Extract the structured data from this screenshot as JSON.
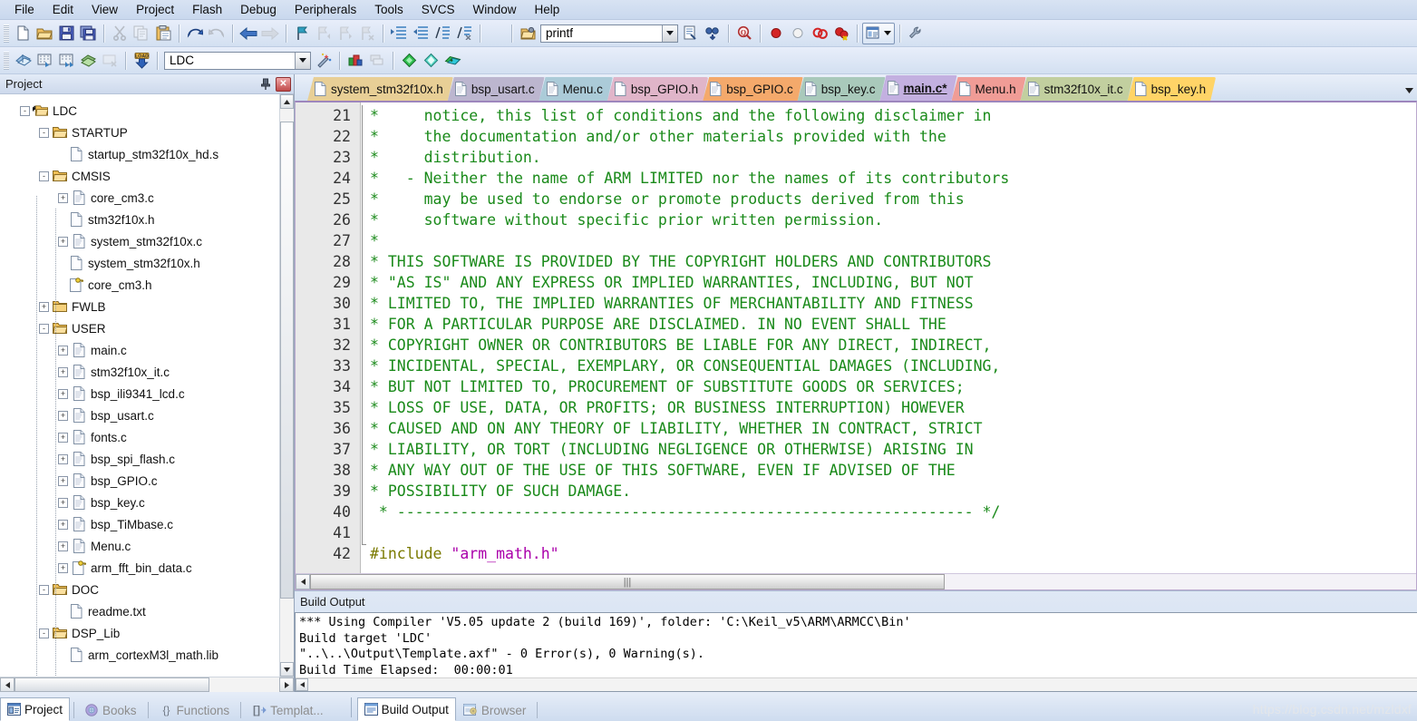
{
  "app": {
    "title": "Keil uVision5"
  },
  "menubar": {
    "items": [
      "File",
      "Edit",
      "View",
      "Project",
      "Flash",
      "Debug",
      "Peripherals",
      "Tools",
      "SVCS",
      "Window",
      "Help"
    ]
  },
  "toolbar_main": {
    "buttons": [
      {
        "name": "new-file",
        "icon": "new-document-icon",
        "disabled": false
      },
      {
        "name": "open-file",
        "icon": "open-folder-icon",
        "disabled": false
      },
      {
        "name": "save",
        "icon": "floppy-save-icon",
        "disabled": false
      },
      {
        "name": "save-all",
        "icon": "save-all-icon",
        "disabled": false
      },
      {
        "name": "cut",
        "icon": "scissors-icon",
        "disabled": true
      },
      {
        "name": "copy",
        "icon": "copy-icon",
        "disabled": true
      },
      {
        "name": "paste",
        "icon": "paste-icon",
        "disabled": false
      },
      {
        "name": "undo",
        "icon": "undo-arrow-icon",
        "disabled": false
      },
      {
        "name": "redo",
        "icon": "redo-arrow-icon",
        "disabled": true
      },
      {
        "name": "navigate-back",
        "icon": "arrow-left-icon",
        "disabled": false
      },
      {
        "name": "navigate-forward",
        "icon": "arrow-right-icon",
        "disabled": true
      },
      {
        "name": "bookmark-toggle",
        "icon": "bookmark-icon",
        "disabled": false
      },
      {
        "name": "bookmark-prev",
        "icon": "bookmark-prev-icon",
        "disabled": true
      },
      {
        "name": "bookmark-next",
        "icon": "bookmark-next-icon",
        "disabled": true
      },
      {
        "name": "bookmark-clear",
        "icon": "bookmark-clear-icon",
        "disabled": true
      },
      {
        "name": "indent",
        "icon": "indent-right-icon",
        "disabled": false
      },
      {
        "name": "outdent",
        "icon": "indent-left-icon",
        "disabled": false
      },
      {
        "name": "comment-lines",
        "icon": "comment-icon",
        "disabled": false
      },
      {
        "name": "uncomment-lines",
        "icon": "uncomment-icon",
        "disabled": false
      },
      {
        "name": "open-document",
        "icon": "open-doc-icon",
        "disabled": false
      }
    ],
    "search_box_value": "printf",
    "search_box_placeholder": "",
    "after_search": [
      {
        "name": "find-in-files",
        "icon": "find-in-files-icon",
        "disabled": false
      },
      {
        "name": "find-next",
        "icon": "binoculars-icon",
        "disabled": false
      },
      {
        "name": "incremental-find",
        "icon": "magnifier-icon",
        "disabled": false
      },
      {
        "name": "insert-breakpoint",
        "icon": "breakpoint-red-dot-icon",
        "disabled": false
      },
      {
        "name": "disable-breakpoint",
        "icon": "breakpoint-disabled-icon",
        "disabled": false
      },
      {
        "name": "kill-all-breakpoints",
        "icon": "breakpoints-clear-icon",
        "disabled": false
      },
      {
        "name": "disable-all-breakpoints",
        "icon": "breakpoints-disable-all-icon",
        "disabled": false
      },
      {
        "name": "window-layout",
        "icon": "window-layout-icon",
        "disabled": false
      },
      {
        "name": "configure-tools",
        "icon": "wrench-icon",
        "disabled": false
      }
    ]
  },
  "toolbar_build": {
    "buttons": [
      {
        "name": "translate-file",
        "icon": "translate-icon",
        "disabled": false
      },
      {
        "name": "build-target",
        "icon": "build-icon",
        "disabled": false
      },
      {
        "name": "rebuild-all",
        "icon": "rebuild-icon",
        "disabled": false
      },
      {
        "name": "batch-build",
        "icon": "batch-build-icon",
        "disabled": false
      },
      {
        "name": "stop-build",
        "icon": "stop-build-icon",
        "disabled": true
      },
      {
        "name": "download-to-flash",
        "icon": "load-download-icon",
        "disabled": false
      }
    ],
    "target_value": "LDC",
    "after_target": [
      {
        "name": "target-options",
        "icon": "magic-wand-icon",
        "disabled": false
      },
      {
        "name": "manage-project-items",
        "icon": "project-items-icon",
        "disabled": false
      },
      {
        "name": "multi-project",
        "icon": "multi-project-icon",
        "disabled": true
      },
      {
        "name": "pack-installer",
        "icon": "green-diamond-icon",
        "disabled": false
      },
      {
        "name": "manage-run-time",
        "icon": "teal-diamond-icon",
        "disabled": false
      },
      {
        "name": "select-software-packs",
        "icon": "packs-icon",
        "disabled": false
      }
    ]
  },
  "project_pane": {
    "title": "Project",
    "pin_icon": "pin-icon",
    "close_icon": "close-icon",
    "tree": [
      {
        "label": "LDC",
        "depth": 0,
        "type": "target",
        "expander": "-",
        "icon": "target-folder-icon"
      },
      {
        "label": "STARTUP",
        "depth": 1,
        "type": "group",
        "expander": "-",
        "icon": "folder-open-icon"
      },
      {
        "label": "startup_stm32f10x_hd.s",
        "depth": 2,
        "type": "file",
        "expander": "",
        "icon": "file-icon"
      },
      {
        "label": "CMSIS",
        "depth": 1,
        "type": "group",
        "expander": "-",
        "icon": "folder-open-icon"
      },
      {
        "label": "core_cm3.c",
        "depth": 2,
        "type": "file",
        "expander": "+",
        "icon": "file-c-icon"
      },
      {
        "label": "stm32f10x.h",
        "depth": 2,
        "type": "file",
        "expander": "",
        "icon": "file-icon"
      },
      {
        "label": "system_stm32f10x.c",
        "depth": 2,
        "type": "file",
        "expander": "+",
        "icon": "file-c-icon"
      },
      {
        "label": "system_stm32f10x.h",
        "depth": 2,
        "type": "file",
        "expander": "",
        "icon": "file-icon"
      },
      {
        "label": "core_cm3.h",
        "depth": 2,
        "type": "file",
        "expander": "",
        "icon": "file-key-icon"
      },
      {
        "label": "FWLB",
        "depth": 1,
        "type": "group",
        "expander": "+",
        "icon": "folder-closed-icon"
      },
      {
        "label": "USER",
        "depth": 1,
        "type": "group",
        "expander": "-",
        "icon": "folder-open-icon"
      },
      {
        "label": "main.c",
        "depth": 2,
        "type": "file",
        "expander": "+",
        "icon": "file-c-icon"
      },
      {
        "label": "stm32f10x_it.c",
        "depth": 2,
        "type": "file",
        "expander": "+",
        "icon": "file-c-icon"
      },
      {
        "label": "bsp_ili9341_lcd.c",
        "depth": 2,
        "type": "file",
        "expander": "+",
        "icon": "file-c-icon"
      },
      {
        "label": "bsp_usart.c",
        "depth": 2,
        "type": "file",
        "expander": "+",
        "icon": "file-c-icon"
      },
      {
        "label": "fonts.c",
        "depth": 2,
        "type": "file",
        "expander": "+",
        "icon": "file-c-icon"
      },
      {
        "label": "bsp_spi_flash.c",
        "depth": 2,
        "type": "file",
        "expander": "+",
        "icon": "file-c-icon"
      },
      {
        "label": "bsp_GPIO.c",
        "depth": 2,
        "type": "file",
        "expander": "+",
        "icon": "file-c-icon"
      },
      {
        "label": "bsp_key.c",
        "depth": 2,
        "type": "file",
        "expander": "+",
        "icon": "file-c-icon"
      },
      {
        "label": "bsp_TiMbase.c",
        "depth": 2,
        "type": "file",
        "expander": "+",
        "icon": "file-c-icon"
      },
      {
        "label": "Menu.c",
        "depth": 2,
        "type": "file",
        "expander": "+",
        "icon": "file-c-icon"
      },
      {
        "label": "arm_fft_bin_data.c",
        "depth": 2,
        "type": "file",
        "expander": "+",
        "icon": "file-key-icon"
      },
      {
        "label": "DOC",
        "depth": 1,
        "type": "group",
        "expander": "-",
        "icon": "folder-open-icon"
      },
      {
        "label": "readme.txt",
        "depth": 2,
        "type": "file",
        "expander": "",
        "icon": "file-icon"
      },
      {
        "label": "DSP_Lib",
        "depth": 1,
        "type": "group",
        "expander": "-",
        "icon": "folder-open-icon"
      },
      {
        "label": "arm_cortexM3l_math.lib",
        "depth": 2,
        "type": "file",
        "expander": "",
        "icon": "file-icon"
      }
    ]
  },
  "editor_tabs": {
    "items": [
      {
        "label": "system_stm32f10x.h",
        "color": "#e8cf96",
        "active": false,
        "modified": false,
        "icon": "file-icon"
      },
      {
        "label": "bsp_usart.c",
        "color": "#bcb6cf",
        "active": false,
        "modified": false,
        "icon": "file-c-icon"
      },
      {
        "label": "Menu.c",
        "color": "#abcbd8",
        "active": false,
        "modified": false,
        "icon": "file-c-icon"
      },
      {
        "label": "bsp_GPIO.h",
        "color": "#e0b5c9",
        "active": false,
        "modified": false,
        "icon": "file-icon"
      },
      {
        "label": "bsp_GPIO.c",
        "color": "#f4a96b",
        "active": false,
        "modified": false,
        "icon": "file-c-icon"
      },
      {
        "label": "bsp_key.c",
        "color": "#a9c9bb",
        "active": false,
        "modified": false,
        "icon": "file-c-icon"
      },
      {
        "label": "main.c*",
        "color": "#c3b0e0",
        "active": true,
        "modified": true,
        "icon": "file-c-icon"
      },
      {
        "label": "Menu.h",
        "color": "#f09c96",
        "active": false,
        "modified": false,
        "icon": "file-icon"
      },
      {
        "label": "stm32f10x_it.c",
        "color": "#c2cf9f",
        "active": false,
        "modified": false,
        "icon": "file-c-icon"
      },
      {
        "label": "bsp_key.h",
        "color": "#ffd467",
        "active": false,
        "modified": false,
        "icon": "file-icon"
      }
    ],
    "overflow_icon": "chevron-down-icon"
  },
  "code": {
    "first_line_number": 21,
    "lines": [
      {
        "n": 21,
        "type": "comment",
        "text": "*     notice, this list of conditions and the following disclaimer in"
      },
      {
        "n": 22,
        "type": "comment",
        "text": "*     the documentation and/or other materials provided with the"
      },
      {
        "n": 23,
        "type": "comment",
        "text": "*     distribution."
      },
      {
        "n": 24,
        "type": "comment",
        "text": "*   - Neither the name of ARM LIMITED nor the names of its contributors"
      },
      {
        "n": 25,
        "type": "comment",
        "text": "*     may be used to endorse or promote products derived from this"
      },
      {
        "n": 26,
        "type": "comment",
        "text": "*     software without specific prior written permission."
      },
      {
        "n": 27,
        "type": "comment",
        "text": "*"
      },
      {
        "n": 28,
        "type": "comment",
        "text": "* THIS SOFTWARE IS PROVIDED BY THE COPYRIGHT HOLDERS AND CONTRIBUTORS"
      },
      {
        "n": 29,
        "type": "comment",
        "text": "* \"AS IS\" AND ANY EXPRESS OR IMPLIED WARRANTIES, INCLUDING, BUT NOT"
      },
      {
        "n": 30,
        "type": "comment",
        "text": "* LIMITED TO, THE IMPLIED WARRANTIES OF MERCHANTABILITY AND FITNESS"
      },
      {
        "n": 31,
        "type": "comment",
        "text": "* FOR A PARTICULAR PURPOSE ARE DISCLAIMED. IN NO EVENT SHALL THE"
      },
      {
        "n": 32,
        "type": "comment",
        "text": "* COPYRIGHT OWNER OR CONTRIBUTORS BE LIABLE FOR ANY DIRECT, INDIRECT,"
      },
      {
        "n": 33,
        "type": "comment",
        "text": "* INCIDENTAL, SPECIAL, EXEMPLARY, OR CONSEQUENTIAL DAMAGES (INCLUDING,"
      },
      {
        "n": 34,
        "type": "comment",
        "text": "* BUT NOT LIMITED TO, PROCUREMENT OF SUBSTITUTE GOODS OR SERVICES;"
      },
      {
        "n": 35,
        "type": "comment",
        "text": "* LOSS OF USE, DATA, OR PROFITS; OR BUSINESS INTERRUPTION) HOWEVER"
      },
      {
        "n": 36,
        "type": "comment",
        "text": "* CAUSED AND ON ANY THEORY OF LIABILITY, WHETHER IN CONTRACT, STRICT"
      },
      {
        "n": 37,
        "type": "comment",
        "text": "* LIABILITY, OR TORT (INCLUDING NEGLIGENCE OR OTHERWISE) ARISING IN"
      },
      {
        "n": 38,
        "type": "comment",
        "text": "* ANY WAY OUT OF THE USE OF THIS SOFTWARE, EVEN IF ADVISED OF THE"
      },
      {
        "n": 39,
        "type": "comment",
        "text": "* POSSIBILITY OF SUCH DAMAGE."
      },
      {
        "n": 40,
        "type": "comment",
        "text": " * ---------------------------------------------------------------- */"
      },
      {
        "n": 41,
        "type": "blank",
        "text": ""
      },
      {
        "n": 42,
        "type": "include",
        "directive": "#include ",
        "target": "\"arm_math.h\""
      }
    ]
  },
  "build_output": {
    "title": "Build Output",
    "lines": [
      "*** Using Compiler 'V5.05 update 2 (build 169)', folder: 'C:\\Keil_v5\\ARM\\ARMCC\\Bin'",
      "Build target 'LDC'",
      "\"..\\..\\Output\\Template.axf\" - 0 Error(s), 0 Warning(s).",
      "Build Time Elapsed:  00:00:01"
    ]
  },
  "bottom_tabs": {
    "left": [
      {
        "label": "Project",
        "icon": "project-window-icon",
        "selected": true
      },
      {
        "label": "Books",
        "icon": "books-icon",
        "selected": false
      },
      {
        "label": "Functions",
        "icon": "functions-braces-icon",
        "selected": false
      },
      {
        "label": "Templat...",
        "icon": "templates-icon",
        "selected": false
      }
    ],
    "right": [
      {
        "label": "Build Output",
        "icon": "build-output-icon",
        "selected": true
      },
      {
        "label": "Browser",
        "icon": "browser-icon",
        "selected": false
      }
    ]
  },
  "watermark": {
    "text": "https://blog.csdn.net/mzldxf"
  }
}
